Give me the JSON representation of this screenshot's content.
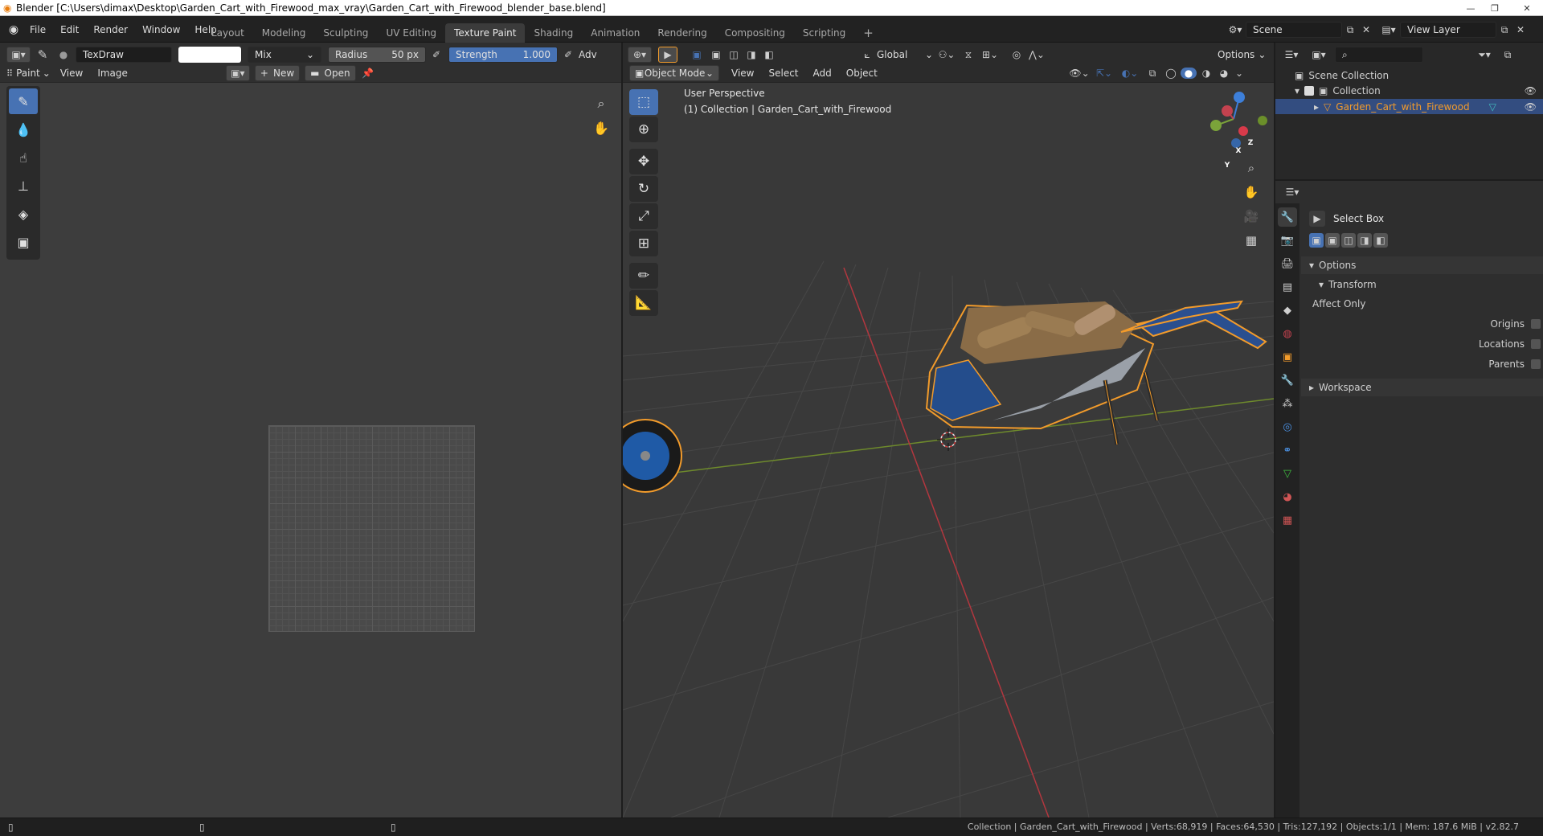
{
  "window": {
    "title": "Blender [C:\\Users\\dimax\\Desktop\\Garden_Cart_with_Firewood_max_vray\\Garden_Cart_with_Firewood_blender_base.blend]"
  },
  "menu": {
    "items": [
      "File",
      "Edit",
      "Render",
      "Window",
      "Help"
    ]
  },
  "workspaces": {
    "tabs": [
      "Layout",
      "Modeling",
      "Sculpting",
      "UV Editing",
      "Texture Paint",
      "Shading",
      "Animation",
      "Rendering",
      "Compositing",
      "Scripting"
    ],
    "active": "Texture Paint"
  },
  "scene": {
    "label": "Scene",
    "view_layer": "View Layer"
  },
  "image_editor": {
    "brush_name": "TexDraw",
    "blend_mode": "Mix",
    "radius_label": "Radius",
    "radius_value": "50 px",
    "strength_label": "Strength",
    "strength_value": "1.000",
    "advanced_label": "Adv",
    "mode_label": "Paint",
    "view_menu": "View",
    "image_menu": "Image",
    "new_button": "New",
    "open_button": "Open"
  },
  "viewport": {
    "mode": "Object Mode",
    "menus": [
      "View",
      "Select",
      "Add",
      "Object"
    ],
    "transform_orientation": "Global",
    "options_label": "Options",
    "overlay_line1": "User Perspective",
    "overlay_line2": "(1) Collection | Garden_Cart_with_Firewood",
    "gizmo_axes": {
      "x": "X",
      "y": "Y",
      "z": "Z"
    }
  },
  "outliner": {
    "scene_collection": "Scene Collection",
    "collection": "Collection",
    "object": "Garden_Cart_with_Firewood"
  },
  "properties": {
    "tool_name": "Select Box",
    "options_header": "Options",
    "transform_header": "Transform",
    "affect_only": "Affect Only",
    "origins": "Origins",
    "locations": "Locations",
    "parents": "Parents",
    "workspace_header": "Workspace"
  },
  "status": {
    "text": "Collection | Garden_Cart_with_Firewood | Verts:68,919 | Faces:64,530 | Tris:127,192 | Objects:1/1 | Mem: 187.6 MiB | v2.82.7"
  },
  "colors": {
    "accent": "#4772b3",
    "selection": "#f29b2b",
    "axis_x": "#c4424f",
    "axis_y": "#7ba33a",
    "axis_z": "#3d7fd9"
  }
}
